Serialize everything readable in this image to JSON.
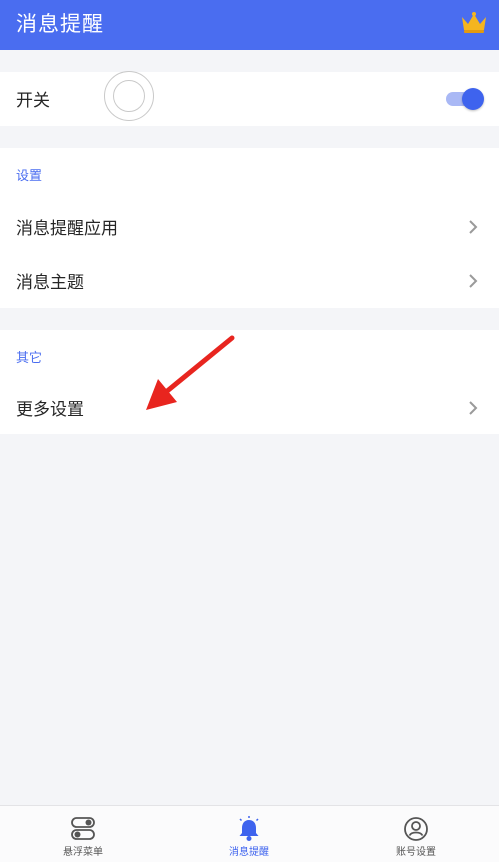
{
  "header": {
    "title": "消息提醒",
    "crown_icon": "crown-icon",
    "crown_color": "#f5b51f"
  },
  "switch_row": {
    "label": "开关",
    "toggle_on": true,
    "toggle_color": "#3e63ee"
  },
  "settings_section": {
    "title": "设置",
    "items": [
      {
        "label": "消息提醒应用"
      },
      {
        "label": "消息主题"
      }
    ]
  },
  "other_section": {
    "title": "其它",
    "items": [
      {
        "label": "更多设置"
      }
    ]
  },
  "annotation": {
    "arrow_color": "#e8251f"
  },
  "tabbar": {
    "tabs": [
      {
        "label": "悬浮菜单",
        "icon": "toggles-icon",
        "active": false
      },
      {
        "label": "消息提醒",
        "icon": "bell-icon",
        "active": true
      },
      {
        "label": "账号设置",
        "icon": "user-circle-icon",
        "active": false
      }
    ]
  },
  "colors": {
    "accent": "#4a6df0",
    "background": "#f4f5f8",
    "card": "#ffffff"
  }
}
